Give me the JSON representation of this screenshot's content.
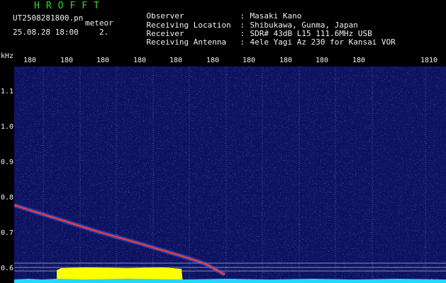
{
  "app": {
    "title": "HROFFT"
  },
  "file": {
    "name": "UT2508281800.pn",
    "tag": "meteor",
    "datetime": "25.08.28 18:00",
    "index": "2."
  },
  "info": [
    {
      "label": "Observer",
      "sep": ":",
      "value": "Masaki Kano"
    },
    {
      "label": "Receiving Location",
      "sep": ":",
      "value": "Shibukawa, Gunma, Japan"
    },
    {
      "label": "Receiver",
      "sep": ":",
      "value": "SDR# 43dB L15 111.6MHz USB"
    },
    {
      "label": "Receiving Antenna",
      "sep": ":",
      "value": "4ele Yagi Az 230 for Kansai VOR"
    }
  ],
  "axis": {
    "unit": "kHz",
    "x_ticks": [
      "180",
      "180",
      "180",
      "180",
      "180",
      "180",
      "180",
      "180",
      "180",
      "180",
      "1810"
    ],
    "y_ticks": [
      "1.1",
      "1.0",
      "0.9",
      "0.8",
      "0.7",
      "0.6"
    ]
  },
  "colors": {
    "background": "#000000",
    "spectrogram": "#0d1260",
    "echo": "#ff3a2a",
    "grid": "#c8c8ff",
    "band": "#ffff00",
    "baseline": "#20d8ff",
    "title": "#22e02a"
  }
}
